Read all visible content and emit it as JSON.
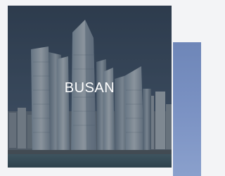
{
  "carousel": {
    "cards": [
      {
        "title": "BUSAN"
      }
    ]
  },
  "colors": {
    "sky": "#3b4f66",
    "water": "#4d6a78",
    "next_card": "#7c93c4",
    "title_text": "#ffffff"
  }
}
